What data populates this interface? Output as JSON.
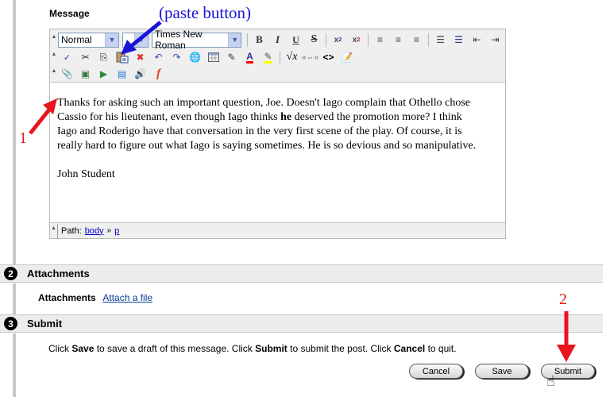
{
  "message": {
    "label": "Message",
    "toolbar": {
      "row1": {
        "format_select": "Normal",
        "size_select": "",
        "font_select": "Times New Roman",
        "buttons": [
          "bold",
          "italic",
          "underline",
          "strikethrough",
          "subscript",
          "superscript",
          "align-left",
          "align-center",
          "align-right",
          "ordered-list",
          "unordered-list",
          "outdent",
          "indent"
        ]
      },
      "row2": {
        "buttons": [
          "spellcheck",
          "cut",
          "copy",
          "paste",
          "remove-format",
          "undo",
          "redo",
          "insert-link",
          "insert-table",
          "draw-line",
          "text-color",
          "highlight-color",
          "equation",
          "anchor",
          "html-source",
          "preview"
        ]
      },
      "row3": {
        "buttons": [
          "attach-file",
          "insert-image",
          "insert-video",
          "insert-web-page",
          "insert-audio",
          "insert-flash"
        ]
      }
    },
    "body": {
      "paragraph1_a": "Thanks for asking such an important question, Joe.  Doesn't Iago complain that Othello chose Cassio for his lieutenant, even though Iago thinks ",
      "paragraph1_bold": "he",
      "paragraph1_b": " deserved the promotion more?  I think Iago and Roderigo have that conversation in the very first scene of the play.  Of course, it is really hard to figure out what Iago is saying sometimes.  He is so devious and so manipulative.",
      "signature": "John Student"
    },
    "path": {
      "label": "Path:",
      "items": [
        "body",
        "p"
      ],
      "separator": "»"
    }
  },
  "sections": {
    "attachments": {
      "number": "2",
      "title": "Attachments",
      "row_label": "Attachments",
      "link": "Attach a file"
    },
    "submit": {
      "number": "3",
      "title": "Submit",
      "instructions": {
        "t1": "Click ",
        "b1": "Save",
        "t2": " to save a draft of this message. Click ",
        "b2": "Submit",
        "t3": " to submit the post. Click ",
        "b3": "Cancel",
        "t4": " to quit."
      },
      "buttons": {
        "cancel": "Cancel",
        "save": "Save",
        "submit": "Submit"
      }
    }
  },
  "annotations": {
    "paste_label": "(paste button)",
    "step1": "1",
    "step2": "2",
    "blue": "#1a14d8",
    "red": "#e8141e"
  }
}
